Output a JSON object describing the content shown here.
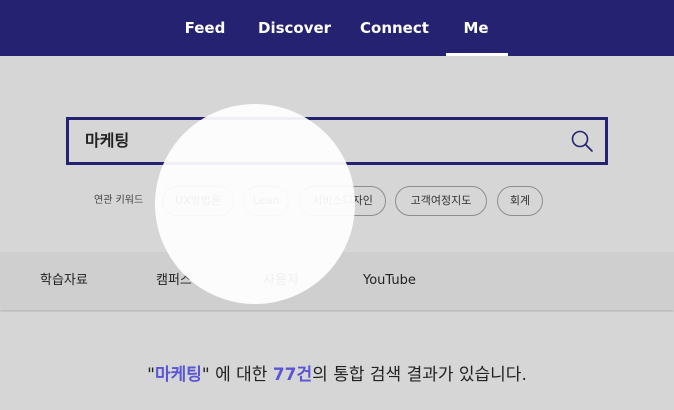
{
  "nav": {
    "items": [
      "Feed",
      "Discover",
      "Connect",
      "Me"
    ],
    "active": "Me"
  },
  "search": {
    "value": "마케팅",
    "icon": "search-icon"
  },
  "related": {
    "label": "연관 키워드",
    "keywords": [
      "UX방법론",
      "Lean",
      "서비스디자인",
      "고객여정지도",
      "회계"
    ]
  },
  "tabs": [
    "학습자료",
    "캠퍼스",
    "사용자",
    "YouTube"
  ],
  "result": {
    "quote_open": "\"",
    "query": "마케팅",
    "quote_close": "\"",
    "mid_text": " 에 대한 ",
    "count": "77건",
    "suffix": "의 통합 검색 결과가 있습니다."
  },
  "colors": {
    "brand": "#252271",
    "highlight": "#5a55d6",
    "background": "#d6d6d6",
    "spotlight": "#ffffff"
  }
}
